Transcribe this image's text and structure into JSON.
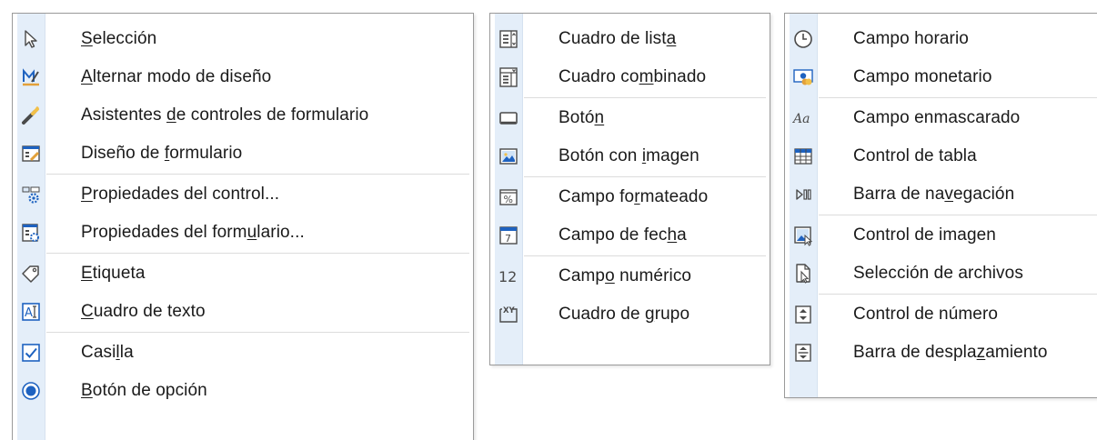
{
  "colors": {
    "accent": "#1e62c0",
    "icon_strip": "#e4eef9",
    "border": "#9a9a9a",
    "text": "#1a1a1a"
  },
  "menus": [
    {
      "groups": [
        [
          {
            "pre": "",
            "u": "S",
            "post": "elección",
            "icon": "pointer-arrow-icon"
          },
          {
            "pre": "",
            "u": "A",
            "post": "lternar modo de diseño",
            "icon": "design-mode-icon"
          },
          {
            "pre": "Asistentes ",
            "u": "d",
            "post": "e controles de formulario",
            "icon": "wizard-wand-icon"
          },
          {
            "pre": "Diseño de ",
            "u": "f",
            "post": "ormulario",
            "icon": "form-design-icon"
          }
        ],
        [
          {
            "pre": "",
            "u": "P",
            "post": "ropiedades del control...",
            "icon": "control-properties-icon"
          },
          {
            "pre": "Propiedades del form",
            "u": "u",
            "post": "lario...",
            "icon": "form-properties-icon"
          }
        ],
        [
          {
            "pre": "",
            "u": "E",
            "post": "tiqueta",
            "icon": "label-tag-icon"
          },
          {
            "pre": "",
            "u": "C",
            "post": "uadro de texto",
            "icon": "text-box-icon"
          }
        ],
        [
          {
            "pre": "Casi",
            "u": "l",
            "post": "la",
            "icon": "checkbox-icon"
          },
          {
            "pre": "",
            "u": "B",
            "post": "otón de opción",
            "icon": "radio-button-icon"
          }
        ]
      ]
    },
    {
      "groups": [
        [
          {
            "pre": "Cuadro de list",
            "u": "a",
            "post": "",
            "icon": "list-box-icon"
          },
          {
            "pre": "Cuadro co",
            "u": "m",
            "post": "binado",
            "icon": "combo-box-icon"
          }
        ],
        [
          {
            "pre": "Botó",
            "u": "n",
            "post": "",
            "icon": "push-button-icon"
          },
          {
            "pre": "Botón con ",
            "u": "i",
            "post": "magen",
            "icon": "image-button-icon"
          }
        ],
        [
          {
            "pre": "Campo fo",
            "u": "r",
            "post": "mateado",
            "icon": "formatted-field-icon"
          },
          {
            "pre": "Campo de fec",
            "u": "h",
            "post": "a",
            "icon": "date-field-icon"
          }
        ],
        [
          {
            "pre": "Camp",
            "u": "o",
            "post": " numérico",
            "icon": "numeric-field-icon"
          },
          {
            "pre": "Cuadro de ",
            "u": "g",
            "post": "rupo",
            "icon": "group-box-icon"
          }
        ]
      ]
    },
    {
      "groups": [
        [
          {
            "pre": "Campo horario",
            "u": "",
            "post": "",
            "icon": "clock-icon"
          },
          {
            "pre": "Campo monetario",
            "u": "",
            "post": "",
            "icon": "currency-field-icon"
          }
        ],
        [
          {
            "pre": "Campo enmascarado",
            "u": "",
            "post": "",
            "icon": "masked-field-icon"
          },
          {
            "pre": "Control de tabla",
            "u": "",
            "post": "",
            "icon": "table-control-icon"
          },
          {
            "pre": "Barra de na",
            "u": "v",
            "post": "egación",
            "icon": "navigation-bar-icon"
          }
        ],
        [
          {
            "pre": "Control de imagen",
            "u": "",
            "post": "",
            "icon": "image-control-icon"
          },
          {
            "pre": "Selección de archivos",
            "u": "",
            "post": "",
            "icon": "file-selection-icon"
          }
        ],
        [
          {
            "pre": "Control de número",
            "u": "",
            "post": "",
            "icon": "spin-button-icon"
          },
          {
            "pre": "Barra de despla",
            "u": "z",
            "post": "amiento",
            "icon": "scrollbar-icon"
          }
        ]
      ]
    }
  ]
}
